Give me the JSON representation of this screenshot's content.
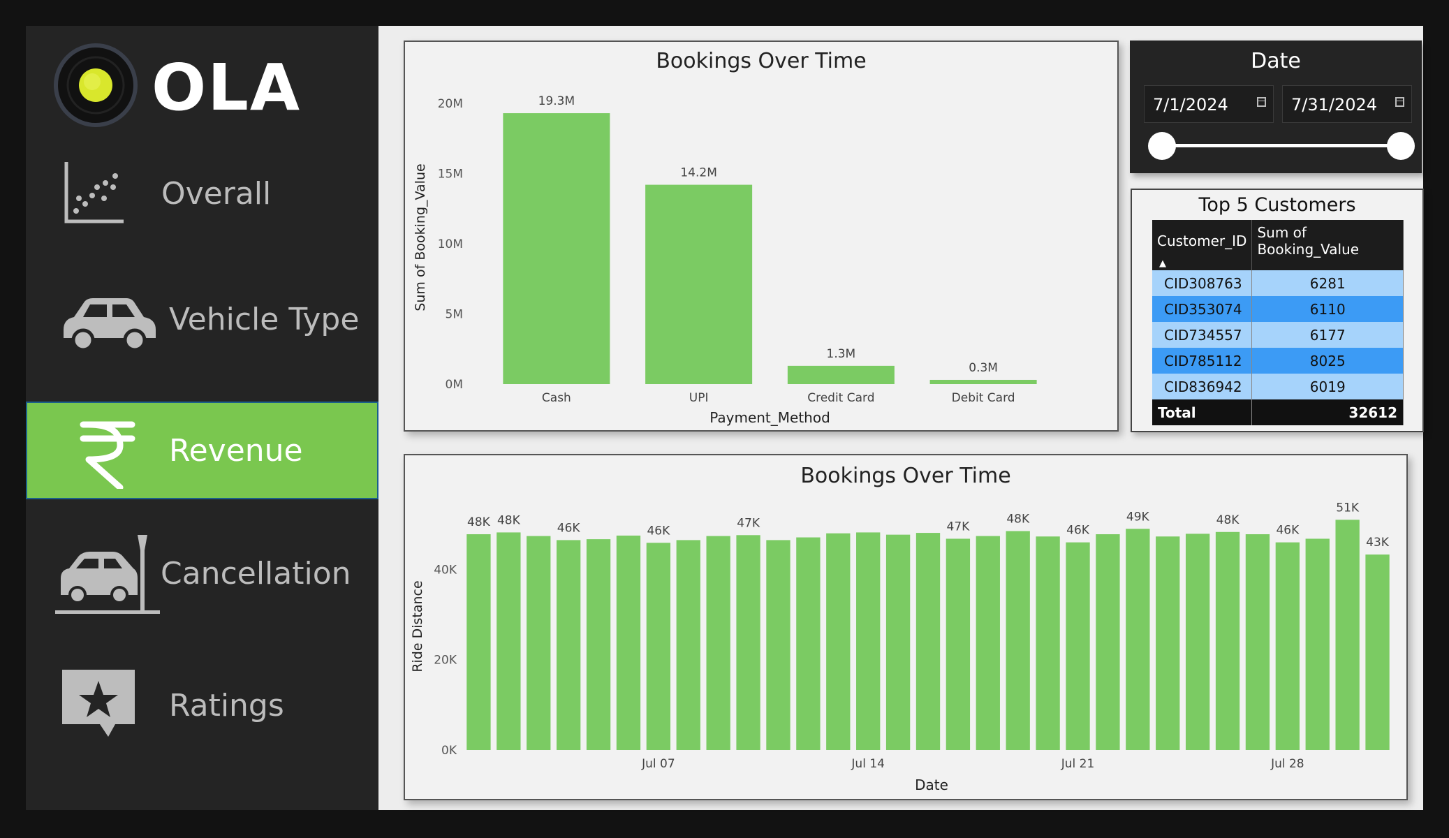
{
  "brand": {
    "name": "OLA"
  },
  "nav": [
    {
      "label": "Overall",
      "icon": "scatter-chart-icon",
      "active": false
    },
    {
      "label": "Vehicle Type",
      "icon": "car-icon",
      "active": false
    },
    {
      "label": "Revenue",
      "icon": "rupee-icon",
      "active": true
    },
    {
      "label": "Cancellation",
      "icon": "car-crash-icon",
      "active": false
    },
    {
      "label": "Ratings",
      "icon": "star-speech-bubble-icon",
      "active": false
    }
  ],
  "colors": {
    "accent": "#7ac74f",
    "bar": "#7bcb63",
    "sidebar": "#242424",
    "row_light": "#a6d3fb",
    "row_dark": "#3c9bf5"
  },
  "date_filter": {
    "title": "Date",
    "start": "7/1/2024",
    "end": "7/31/2024"
  },
  "top_customers": {
    "title": "Top 5 Customers",
    "columns": [
      "Customer_ID",
      "Sum of Booking_Value"
    ],
    "rows": [
      {
        "id": "CID308763",
        "value": "6281"
      },
      {
        "id": "CID353074",
        "value": "6110"
      },
      {
        "id": "CID734557",
        "value": "6177"
      },
      {
        "id": "CID785112",
        "value": "8025"
      },
      {
        "id": "CID836942",
        "value": "6019"
      }
    ],
    "total_label": "Total",
    "total_value": "32612"
  },
  "chart_data": [
    {
      "type": "bar",
      "title": "Bookings Over Time",
      "xlabel": "Payment_Method",
      "ylabel": "Sum of Booking_Value",
      "categories": [
        "Cash",
        "UPI",
        "Credit Card",
        "Debit Card"
      ],
      "values": [
        19.3,
        14.2,
        1.3,
        0.3
      ],
      "data_labels": [
        "19.3M",
        "14.2M",
        "1.3M",
        "0.3M"
      ],
      "ylim": [
        0,
        20
      ],
      "yticks": [
        0,
        5,
        10,
        15,
        20
      ],
      "ytick_labels": [
        "0M",
        "5M",
        "10M",
        "15M",
        "20M"
      ],
      "grid": false
    },
    {
      "type": "bar",
      "title": "Bookings Over Time",
      "xlabel": "Date",
      "ylabel": "Ride Distance",
      "x": [
        "2024-07-01",
        "2024-07-02",
        "2024-07-03",
        "2024-07-04",
        "2024-07-05",
        "2024-07-06",
        "2024-07-07",
        "2024-07-08",
        "2024-07-09",
        "2024-07-10",
        "2024-07-11",
        "2024-07-12",
        "2024-07-13",
        "2024-07-14",
        "2024-07-15",
        "2024-07-16",
        "2024-07-17",
        "2024-07-18",
        "2024-07-19",
        "2024-07-20",
        "2024-07-21",
        "2024-07-22",
        "2024-07-23",
        "2024-07-24",
        "2024-07-25",
        "2024-07-26",
        "2024-07-27",
        "2024-07-28",
        "2024-07-29",
        "2024-07-30",
        "2024-07-31"
      ],
      "values": [
        47800,
        48200,
        47400,
        46500,
        46700,
        47500,
        45900,
        46500,
        47400,
        47600,
        46500,
        47100,
        48000,
        48200,
        47700,
        48100,
        46800,
        47400,
        48500,
        47300,
        46000,
        47800,
        49000,
        47300,
        47900,
        48300,
        47800,
        46000,
        46800,
        51000,
        43300
      ],
      "data_labels": [
        "48K",
        "48K",
        "",
        "46K",
        "",
        "",
        "46K",
        "",
        "",
        "47K",
        "",
        "",
        "",
        "",
        "",
        "",
        "47K",
        "",
        "48K",
        "",
        "46K",
        "",
        "49K",
        "",
        "",
        "48K",
        "",
        "46K",
        "",
        "51K",
        "43K"
      ],
      "xtick_labels": [
        "Jul 07",
        "Jul 14",
        "Jul 21",
        "Jul 28"
      ],
      "ylim": [
        0,
        56000
      ],
      "yticks": [
        0,
        20000,
        40000
      ],
      "ytick_labels": [
        "0K",
        "20K",
        "40K"
      ],
      "grid": false
    }
  ]
}
